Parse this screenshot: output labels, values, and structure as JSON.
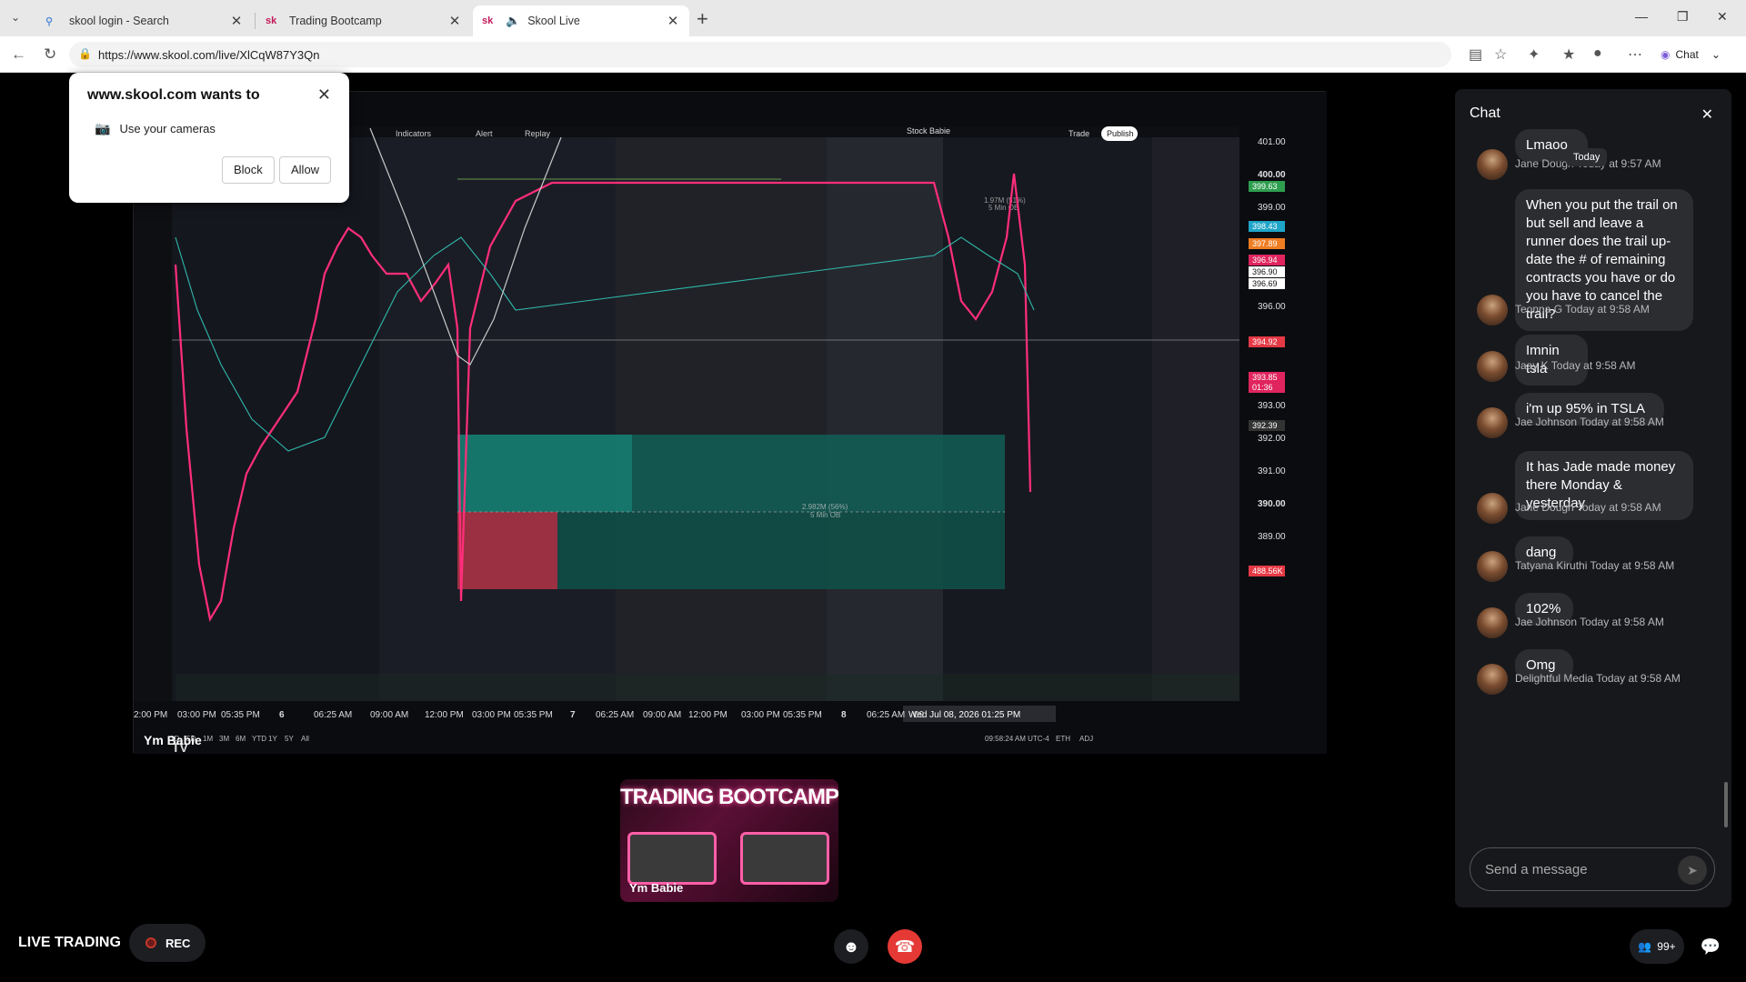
{
  "browser": {
    "tabs": [
      {
        "label": "skool login - Search",
        "icon": "search-icon"
      },
      {
        "label": "Trading Bootcamp",
        "icon": "sk"
      },
      {
        "label": "Skool Live",
        "icon": "sk"
      }
    ],
    "url": "https://www.skool.com/live/XlCqW87Y3Qn",
    "chat_button": "Chat"
  },
  "permission": {
    "title": "www.skool.com wants to",
    "request": "Use your cameras",
    "block_label": "Block",
    "allow_label": "Allow"
  },
  "chart": {
    "toolbar": {
      "indicators": "Indicators",
      "alert": "Alert",
      "replay": "Replay",
      "layout_name": "Stock Babie",
      "trade": "Trade",
      "publish": "Publish"
    },
    "price_ticks": [
      "401.00",
      "400.00",
      "399.00",
      "396.00",
      "393.00",
      "392.00",
      "391.00",
      "390.00",
      "389.00"
    ],
    "price_tags": [
      {
        "label": "399.63",
        "color": "#2e9e4f"
      },
      {
        "label": "398.43",
        "color": "#1fa5c8"
      },
      {
        "label": "397.89",
        "color": "#ef7d22"
      },
      {
        "label": "396.94",
        "color": "#e0245e"
      },
      {
        "label": "396.90",
        "color": "#ffffff"
      },
      {
        "label": "396.69",
        "color": "#ffffff"
      },
      {
        "label": "394.92",
        "color": "#e53945"
      },
      {
        "label": "393.85",
        "color": "#e0245e"
      },
      {
        "label": "01:36",
        "color": "#e0245e"
      },
      {
        "label": "392.39",
        "color": "#333333"
      },
      {
        "label": "488.56K",
        "color": "#e53945"
      }
    ],
    "time_ticks": [
      "2:00 PM",
      "03:00 PM",
      "05:35 PM",
      "6",
      "06:25 AM",
      "09:00 AM",
      "12:00 PM",
      "03:00 PM",
      "05:35 PM",
      "7",
      "06:25 AM",
      "09:00 AM",
      "12:00 PM",
      "03:00 PM",
      "05:35 PM",
      "8",
      "06:25 AM",
      "09"
    ],
    "crosshair_time": "Wed Jul 08, 2026   01:25 PM",
    "ranges": [
      "1D",
      "5D",
      "1M",
      "3M",
      "6M",
      "YTD",
      "1Y",
      "5Y",
      "All"
    ],
    "status_time": "09:58:24 AM UTC-4",
    "eth": "ETH",
    "adj": "ADJ",
    "zone_label_1": "2.982M (56%)",
    "zone_label_2": "5 Min OB",
    "zone_label_3": "1.97M (51%)",
    "zone_label_4": "5 Min OB",
    "logo": "TV"
  },
  "host_label": "Ym Babie",
  "chat": {
    "title": "Chat",
    "today": "Today",
    "messages": [
      {
        "text": "Lmaoo",
        "author": "Jane Dough",
        "time": "Today at 9:57 AM"
      },
      {
        "text": "When you put the trail on but sell and leave a runner does the trail up-date the # of remaining contracts you have or do you have to cancel the trail?",
        "author": "Teonna G",
        "time": "Today at 9:58 AM"
      },
      {
        "text": "Imnin tsla",
        "author": "Jaay K",
        "time": "Today at 9:58 AM"
      },
      {
        "text": "i'm up 95% in TSLA",
        "author": "Jae Johnson",
        "time": "Today at 9:58 AM"
      },
      {
        "text": "It has Jade made money there Monday & yesterday",
        "author": "Jane Dough",
        "time": "Today at 9:58 AM"
      },
      {
        "text": "dang",
        "author": "Tatyana Kiruthi",
        "time": "Today at 9:58 AM"
      },
      {
        "text": "102%",
        "author": "Jae Johnson",
        "time": "Today at 9:58 AM"
      },
      {
        "text": "Omg",
        "author": "Delightful Media",
        "time": "Today at 9:58 AM"
      }
    ],
    "input_placeholder": "Send a message"
  },
  "bottom": {
    "title": "LIVE TRADING",
    "rec": "REC",
    "participants": "99+"
  },
  "thumbnail": {
    "title": "TRADING BOOTCAMP",
    "name": "Ym Babie"
  }
}
